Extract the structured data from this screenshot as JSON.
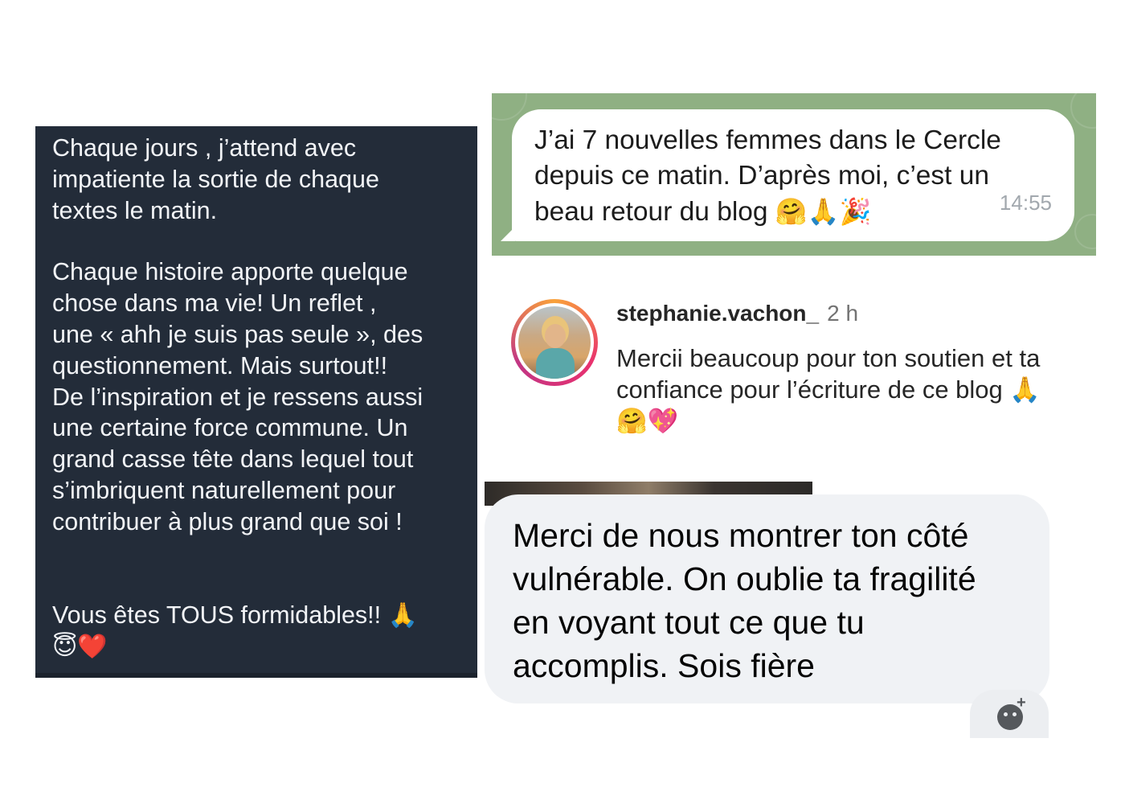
{
  "left_message": {
    "para1": "Chaque jours , j’attend avec\nimpatiente la sortie de chaque\ntextes le matin.",
    "para2": "Chaque histoire apporte quelque\nchose dans ma vie! Un reflet ,\nune « ahh je suis pas seule », des\nquestionnement. Mais surtout!!\nDe l’inspiration et je ressens aussi\nune certaine force commune. Un\ngrand casse tête dans lequel tout\ns’imbriquent naturellement pour\ncontribuer à plus grand que soi !",
    "para3": "Vous êtes TOUS formidables!! ",
    "emoji1": "🙏",
    "emoji2": "😇❤️"
  },
  "green_message": {
    "text": "J’ai 7 nouvelles femmes dans le Cercle\ndepuis ce matin. D’après moi, c’est un\nbeau retour du blog ",
    "emojis": "🤗🙏🎉",
    "time": "14:55"
  },
  "instagram_comment": {
    "username": "stephanie.vachon_",
    "time": "2 h",
    "line1": "Mercii beaucoup pour ton soutien et ta",
    "line2": "confiance pour l’écriture de ce blog 🙏",
    "line3": "🤗💖"
  },
  "grey_message": {
    "text": "Merci de nous montrer ton côté\nvulnérable. On oublie ta fragilité\nen voyant tout ce que tu\naccomplis. Sois fière"
  },
  "colors": {
    "dark_card_bg": "#232c39",
    "green_bg": "#8fb083",
    "grey_bubble_bg": "#f0f2f5"
  },
  "icons": {
    "reaction": "add-reaction-icon"
  }
}
